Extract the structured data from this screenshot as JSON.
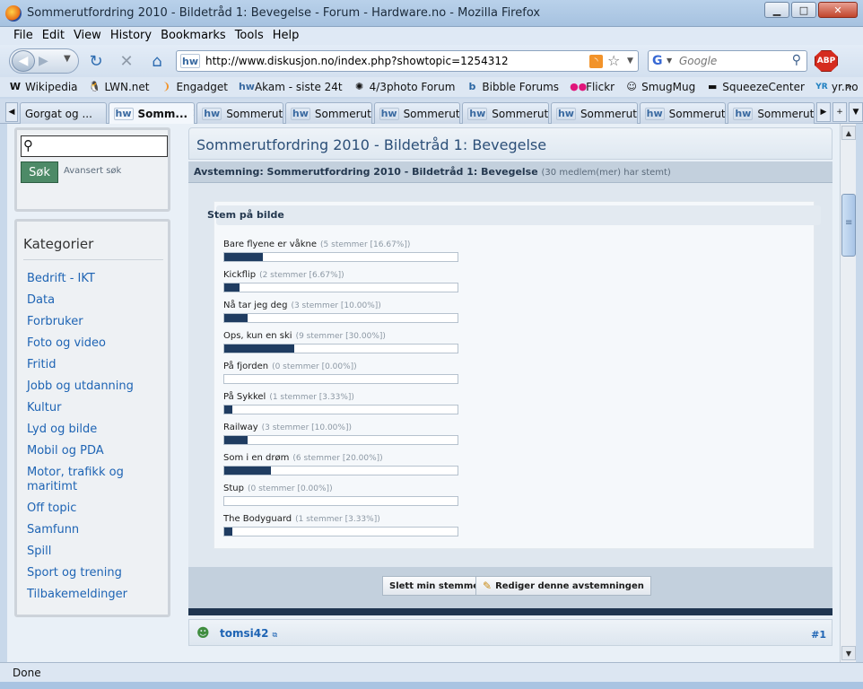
{
  "window": {
    "title": "Sommerutfordring 2010 - Bildetråd 1: Bevegelse - Forum - Hardware.no - Mozilla Firefox",
    "minimize": "▁",
    "maximize": "□",
    "close": "✕"
  },
  "menu": [
    "File",
    "Edit",
    "View",
    "History",
    "Bookmarks",
    "Tools",
    "Help"
  ],
  "nav": {
    "url": "http://www.diskusjon.no/index.php?showtopic=1254312",
    "url_favicon": "hw",
    "search_placeholder": "Google",
    "search_engine": "G",
    "abp": "ABP"
  },
  "bookmarks": [
    {
      "label": "Wikipedia",
      "icon": "W"
    },
    {
      "label": "LWN.net",
      "icon": "🐧"
    },
    {
      "label": "Engadget",
      "icon": "❩"
    },
    {
      "label": "Akam - siste 24t",
      "icon": "hw"
    },
    {
      "label": "4/3photo Forum",
      "icon": "✺"
    },
    {
      "label": "Bibble Forums",
      "icon": "b"
    },
    {
      "label": "Flickr",
      "icon": "●●"
    },
    {
      "label": "SmugMug",
      "icon": "☺"
    },
    {
      "label": "SqueezeCenter",
      "icon": "▬"
    },
    {
      "label": "yr.no",
      "icon": "YR"
    }
  ],
  "bookmarks_more": "»",
  "tabs": [
    {
      "label": "Gorgat og ...",
      "icon": "",
      "active": false
    },
    {
      "label": "Somm...",
      "icon": "hw",
      "active": true,
      "close": "✕"
    },
    {
      "label": "Sommerut...",
      "icon": "hw",
      "active": false
    },
    {
      "label": "Sommerut...",
      "icon": "hw",
      "active": false
    },
    {
      "label": "Sommerut...",
      "icon": "hw",
      "active": false
    },
    {
      "label": "Sommerut...",
      "icon": "hw",
      "active": false
    },
    {
      "label": "Sommerut...",
      "icon": "hw",
      "active": false
    },
    {
      "label": "Sommerut...",
      "icon": "hw",
      "active": false
    },
    {
      "label": "Sommerut...",
      "icon": "hw",
      "active": false
    }
  ],
  "sidebar": {
    "search_button": "Søk",
    "advanced": "Avansert søk",
    "categories_title": "Kategorier",
    "categories": [
      "Bedrift - IKT",
      "Data",
      "Forbruker",
      "Foto og video",
      "Fritid",
      "Jobb og utdanning",
      "Kultur",
      "Lyd og bilde",
      "Mobil og PDA",
      "Motor, trafikk og maritimt",
      "Off topic",
      "Samfunn",
      "Spill",
      "Sport og trening",
      "Tilbakemeldinger"
    ]
  },
  "topic": {
    "title": "Sommerutfordring 2010 - Bildetråd 1: Bevegelse",
    "poll_question": "Avstemning: Sommerutfordring 2010 - Bildetråd 1: Bevegelse",
    "poll_count": "(30 medlem(mer) har stemt)",
    "vote_heading": "Stem på bilde",
    "options": [
      {
        "label": "Bare flyene er våkne",
        "meta": "(5 stemmer [16.67%])",
        "pct": 16.67
      },
      {
        "label": "Kickflip",
        "meta": "(2 stemmer [6.67%])",
        "pct": 6.67
      },
      {
        "label": "Nå tar jeg deg",
        "meta": "(3 stemmer [10.00%])",
        "pct": 10.0
      },
      {
        "label": "Ops, kun en ski",
        "meta": "(9 stemmer [30.00%])",
        "pct": 30.0
      },
      {
        "label": "På fjorden",
        "meta": "(0 stemmer [0.00%])",
        "pct": 0
      },
      {
        "label": "På Sykkel",
        "meta": "(1 stemmer [3.33%])",
        "pct": 3.33
      },
      {
        "label": "Railway",
        "meta": "(3 stemmer [10.00%])",
        "pct": 10.0
      },
      {
        "label": "Som i en drøm",
        "meta": "(6 stemmer [20.00%])",
        "pct": 20.0
      },
      {
        "label": "Stup",
        "meta": "(0 stemmer [0.00%])",
        "pct": 0
      },
      {
        "label": "The Bodyguard",
        "meta": "(1 stemmer [3.33%])",
        "pct": 3.33
      }
    ],
    "delete_vote": "Slett min stemme",
    "edit_poll": "Rediger denne avstemningen",
    "first_post_user": "tomsi42",
    "first_post_number": "#1"
  },
  "status": "Done"
}
